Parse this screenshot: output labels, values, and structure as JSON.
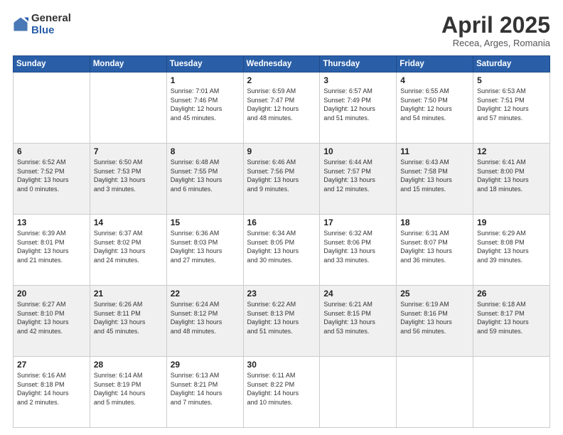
{
  "header": {
    "logo_general": "General",
    "logo_blue": "Blue",
    "title": "April 2025",
    "location": "Recea, Arges, Romania"
  },
  "days_of_week": [
    "Sunday",
    "Monday",
    "Tuesday",
    "Wednesday",
    "Thursday",
    "Friday",
    "Saturday"
  ],
  "weeks": [
    [
      {
        "num": "",
        "detail": ""
      },
      {
        "num": "",
        "detail": ""
      },
      {
        "num": "1",
        "detail": "Sunrise: 7:01 AM\nSunset: 7:46 PM\nDaylight: 12 hours\nand 45 minutes."
      },
      {
        "num": "2",
        "detail": "Sunrise: 6:59 AM\nSunset: 7:47 PM\nDaylight: 12 hours\nand 48 minutes."
      },
      {
        "num": "3",
        "detail": "Sunrise: 6:57 AM\nSunset: 7:49 PM\nDaylight: 12 hours\nand 51 minutes."
      },
      {
        "num": "4",
        "detail": "Sunrise: 6:55 AM\nSunset: 7:50 PM\nDaylight: 12 hours\nand 54 minutes."
      },
      {
        "num": "5",
        "detail": "Sunrise: 6:53 AM\nSunset: 7:51 PM\nDaylight: 12 hours\nand 57 minutes."
      }
    ],
    [
      {
        "num": "6",
        "detail": "Sunrise: 6:52 AM\nSunset: 7:52 PM\nDaylight: 13 hours\nand 0 minutes."
      },
      {
        "num": "7",
        "detail": "Sunrise: 6:50 AM\nSunset: 7:53 PM\nDaylight: 13 hours\nand 3 minutes."
      },
      {
        "num": "8",
        "detail": "Sunrise: 6:48 AM\nSunset: 7:55 PM\nDaylight: 13 hours\nand 6 minutes."
      },
      {
        "num": "9",
        "detail": "Sunrise: 6:46 AM\nSunset: 7:56 PM\nDaylight: 13 hours\nand 9 minutes."
      },
      {
        "num": "10",
        "detail": "Sunrise: 6:44 AM\nSunset: 7:57 PM\nDaylight: 13 hours\nand 12 minutes."
      },
      {
        "num": "11",
        "detail": "Sunrise: 6:43 AM\nSunset: 7:58 PM\nDaylight: 13 hours\nand 15 minutes."
      },
      {
        "num": "12",
        "detail": "Sunrise: 6:41 AM\nSunset: 8:00 PM\nDaylight: 13 hours\nand 18 minutes."
      }
    ],
    [
      {
        "num": "13",
        "detail": "Sunrise: 6:39 AM\nSunset: 8:01 PM\nDaylight: 13 hours\nand 21 minutes."
      },
      {
        "num": "14",
        "detail": "Sunrise: 6:37 AM\nSunset: 8:02 PM\nDaylight: 13 hours\nand 24 minutes."
      },
      {
        "num": "15",
        "detail": "Sunrise: 6:36 AM\nSunset: 8:03 PM\nDaylight: 13 hours\nand 27 minutes."
      },
      {
        "num": "16",
        "detail": "Sunrise: 6:34 AM\nSunset: 8:05 PM\nDaylight: 13 hours\nand 30 minutes."
      },
      {
        "num": "17",
        "detail": "Sunrise: 6:32 AM\nSunset: 8:06 PM\nDaylight: 13 hours\nand 33 minutes."
      },
      {
        "num": "18",
        "detail": "Sunrise: 6:31 AM\nSunset: 8:07 PM\nDaylight: 13 hours\nand 36 minutes."
      },
      {
        "num": "19",
        "detail": "Sunrise: 6:29 AM\nSunset: 8:08 PM\nDaylight: 13 hours\nand 39 minutes."
      }
    ],
    [
      {
        "num": "20",
        "detail": "Sunrise: 6:27 AM\nSunset: 8:10 PM\nDaylight: 13 hours\nand 42 minutes."
      },
      {
        "num": "21",
        "detail": "Sunrise: 6:26 AM\nSunset: 8:11 PM\nDaylight: 13 hours\nand 45 minutes."
      },
      {
        "num": "22",
        "detail": "Sunrise: 6:24 AM\nSunset: 8:12 PM\nDaylight: 13 hours\nand 48 minutes."
      },
      {
        "num": "23",
        "detail": "Sunrise: 6:22 AM\nSunset: 8:13 PM\nDaylight: 13 hours\nand 51 minutes."
      },
      {
        "num": "24",
        "detail": "Sunrise: 6:21 AM\nSunset: 8:15 PM\nDaylight: 13 hours\nand 53 minutes."
      },
      {
        "num": "25",
        "detail": "Sunrise: 6:19 AM\nSunset: 8:16 PM\nDaylight: 13 hours\nand 56 minutes."
      },
      {
        "num": "26",
        "detail": "Sunrise: 6:18 AM\nSunset: 8:17 PM\nDaylight: 13 hours\nand 59 minutes."
      }
    ],
    [
      {
        "num": "27",
        "detail": "Sunrise: 6:16 AM\nSunset: 8:18 PM\nDaylight: 14 hours\nand 2 minutes."
      },
      {
        "num": "28",
        "detail": "Sunrise: 6:14 AM\nSunset: 8:19 PM\nDaylight: 14 hours\nand 5 minutes."
      },
      {
        "num": "29",
        "detail": "Sunrise: 6:13 AM\nSunset: 8:21 PM\nDaylight: 14 hours\nand 7 minutes."
      },
      {
        "num": "30",
        "detail": "Sunrise: 6:11 AM\nSunset: 8:22 PM\nDaylight: 14 hours\nand 10 minutes."
      },
      {
        "num": "",
        "detail": ""
      },
      {
        "num": "",
        "detail": ""
      },
      {
        "num": "",
        "detail": ""
      }
    ]
  ]
}
